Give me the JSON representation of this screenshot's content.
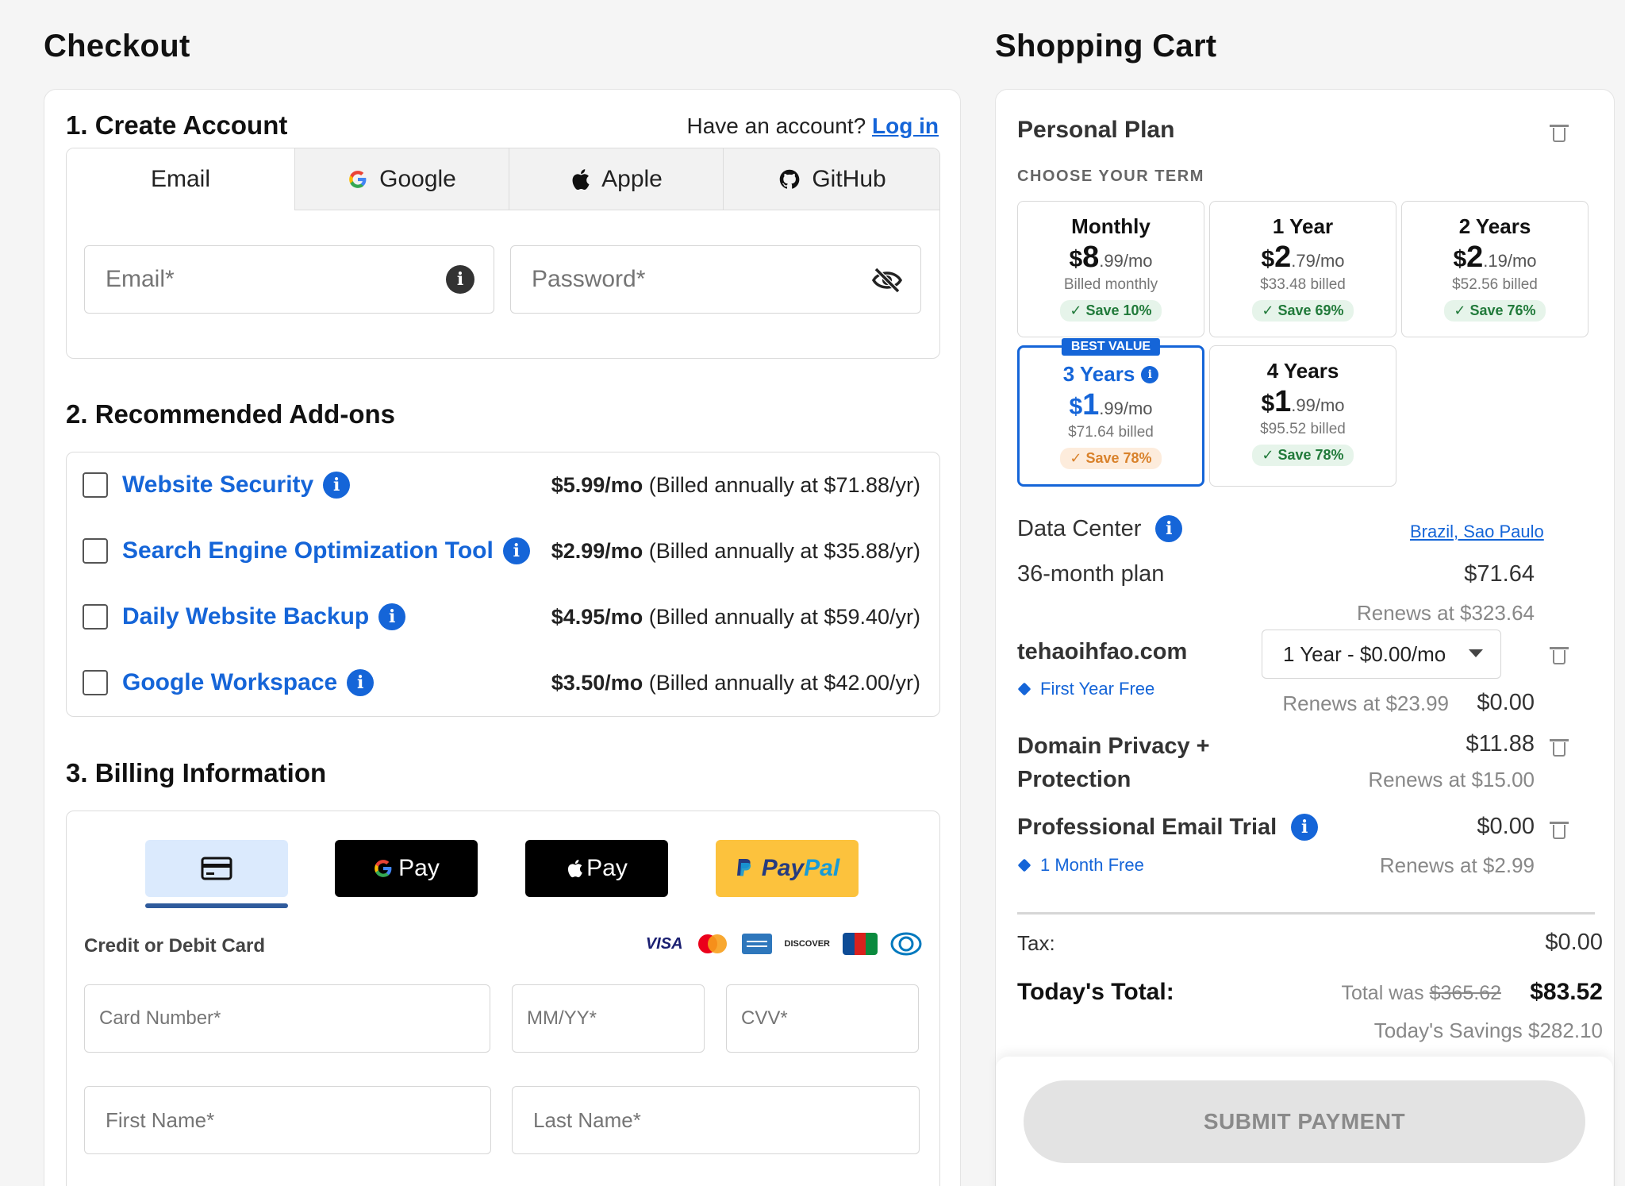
{
  "checkout": {
    "title": "Checkout",
    "account": {
      "title": "1. Create Account",
      "have_account": "Have an account?",
      "login": "Log in",
      "tabs": [
        "Email",
        "Google",
        "Apple",
        "GitHub"
      ],
      "email_placeholder": "Email*",
      "password_placeholder": "Password*"
    },
    "addons": {
      "title": "2. Recommended Add-ons",
      "items": [
        {
          "name": "Website Security",
          "price": "$5.99/mo",
          "billed": "(Billed annually at $71.88/yr)"
        },
        {
          "name": "Search Engine Optimization Tool",
          "price": "$2.99/mo",
          "billed": "(Billed annually at $35.88/yr)"
        },
        {
          "name": "Daily Website Backup",
          "price": "$4.95/mo",
          "billed": "(Billed annually at $59.40/yr)"
        },
        {
          "name": "Google Workspace",
          "price": "$3.50/mo",
          "billed": "(Billed annually at $42.00/yr)"
        }
      ]
    },
    "billing": {
      "title": "3. Billing Information",
      "gpay": "Pay",
      "applepay": "Pay",
      "paypal_pay": "Pay",
      "paypal_pal": "Pal",
      "card_label": "Credit or Debit Card",
      "card_brands": [
        "VISA",
        "DISCOVER",
        "JCB"
      ],
      "card_number": "Card Number*",
      "expiry": "MM/YY*",
      "cvv": "CVV*",
      "first_name": "First Name*",
      "last_name": "Last Name*"
    }
  },
  "cart": {
    "title": "Shopping Cart",
    "plan": "Personal Plan",
    "choose_term": "CHOOSE YOUR TERM",
    "terms": [
      {
        "name": "Monthly",
        "dollars": "8",
        "cents": ".99/mo",
        "billed": "Billed monthly",
        "save": "Save 10%"
      },
      {
        "name": "1 Year",
        "dollars": "2",
        "cents": ".79/mo",
        "billed": "$33.48 billed",
        "save": "Save 69%"
      },
      {
        "name": "2 Years",
        "dollars": "2",
        "cents": ".19/mo",
        "billed": "$52.56 billed",
        "save": "Save 76%"
      },
      {
        "name": "3 Years",
        "dollars": "1",
        "cents": ".99/mo",
        "billed": "$71.64 billed",
        "save": "Save 78%",
        "badge": "BEST VALUE"
      },
      {
        "name": "4 Years",
        "dollars": "1",
        "cents": ".99/mo",
        "billed": "$95.52 billed",
        "save": "Save 78%"
      }
    ],
    "data_center_label": "Data Center",
    "data_center_value": "Brazil, Sao Paulo",
    "plan_line": "36-month plan",
    "plan_price": "$71.64",
    "plan_renews": "Renews at $323.64",
    "domain": "tehaoihfao.com",
    "domain_select": "1 Year - $0.00/mo",
    "domain_tag": "First Year Free",
    "domain_renews": "Renews at $23.99",
    "domain_price": "$0.00",
    "privacy_line1": "Domain Privacy +",
    "privacy_line2": "Protection",
    "privacy_price": "$11.88",
    "privacy_renews": "Renews at $15.00",
    "email_trial": "Professional Email Trial",
    "email_price": "$0.00",
    "email_tag": "1 Month Free",
    "email_renews": "Renews at $2.99",
    "tax_label": "Tax:",
    "tax_value": "$0.00",
    "total_label": "Today's Total:",
    "total_was_label": "Total was",
    "total_was": "$365.62",
    "total": "$83.52",
    "savings": "Today's Savings $282.10",
    "submit": "SUBMIT PAYMENT"
  }
}
